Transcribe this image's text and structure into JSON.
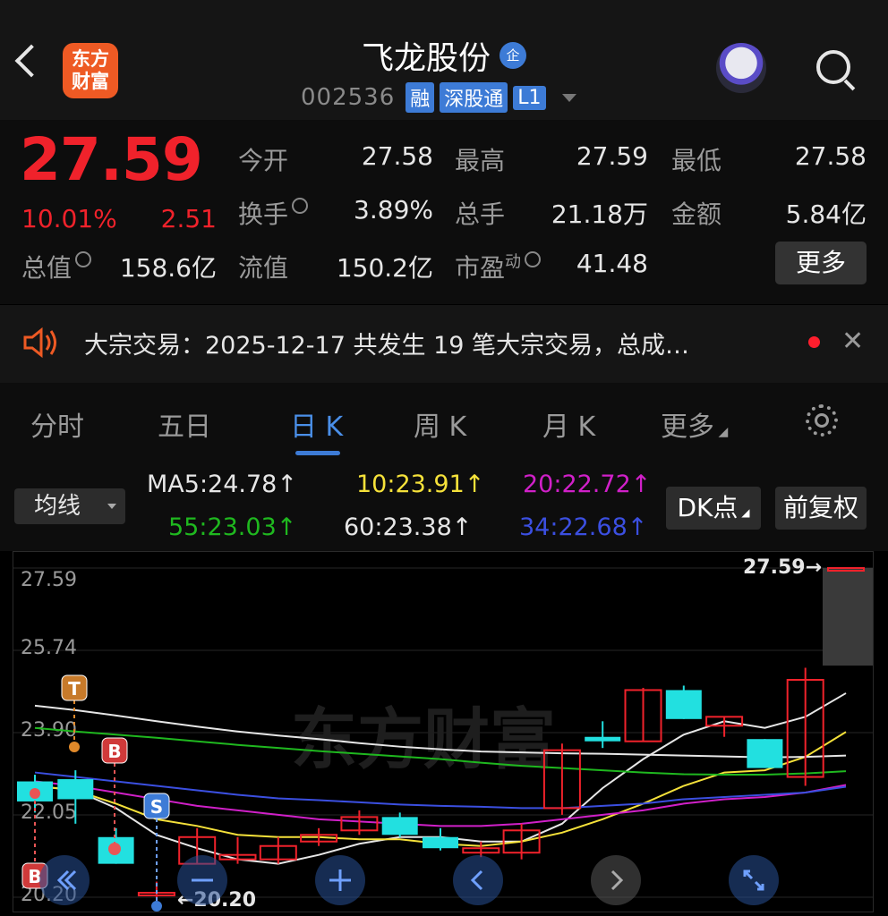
{
  "header": {
    "logo_line1": "东方",
    "logo_line2": "财富",
    "stock_name": "飞龙股份",
    "badge": "企",
    "code": "002536",
    "tags": [
      "融",
      "深股通",
      "L1"
    ]
  },
  "quote": {
    "price": "27.59",
    "change_pct": "10.01%",
    "change_amt": "2.51",
    "fields": [
      {
        "label": "今开",
        "value": "27.58",
        "color": "red"
      },
      {
        "label": "最高",
        "value": "27.59",
        "color": "red"
      },
      {
        "label": "最低",
        "value": "27.58",
        "color": "red"
      },
      {
        "label": "换手",
        "value": "3.89%"
      },
      {
        "label": "总手",
        "value": "21.18万"
      },
      {
        "label": "金额",
        "value": "5.84亿"
      },
      {
        "label": "总值",
        "value": "158.6亿"
      },
      {
        "label": "流值",
        "value": "150.2亿"
      },
      {
        "label": "市盈",
        "label_sup": "动",
        "value": "41.48"
      }
    ],
    "more_label": "更多"
  },
  "notice": {
    "text": "大宗交易：2025-12-17 共发生 19 笔大宗交易，总成…"
  },
  "tabs": [
    "分时",
    "五日",
    "日 K",
    "周 K",
    "月 K",
    "更多"
  ],
  "active_tab": "日 K",
  "ma_panel": {
    "selector": "均线",
    "items": [
      {
        "label": "MA5:24.78↑",
        "color": "#e6e6e6"
      },
      {
        "label": "10:23.91↑",
        "color": "#f5e13a"
      },
      {
        "label": "20:22.72↑",
        "color": "#d020c8"
      },
      {
        "label": "55:23.03↑",
        "color": "#1fb81f"
      },
      {
        "label": "60:23.38↑",
        "color": "#e6e6e6"
      },
      {
        "label": "34:22.68↑",
        "color": "#3b4fe0"
      }
    ],
    "dk_button": "DK点",
    "fq_button": "前复权"
  },
  "chart_data": {
    "type": "candlestick",
    "y_ticks": [
      "27.59",
      "25.74",
      "23.90",
      "22.05",
      "20.20"
    ],
    "ylim": [
      20.2,
      27.59
    ],
    "last_price_label": "27.59→",
    "low_label": "←20.20",
    "watermark": "东方财富",
    "markers": [
      "T",
      "B",
      "S",
      "B"
    ],
    "candles": [
      {
        "o": 22.8,
        "c": 22.35,
        "h": 22.95,
        "l": 22.1,
        "up": false
      },
      {
        "o": 22.85,
        "c": 22.4,
        "h": 23.05,
        "l": 21.85,
        "up": false
      },
      {
        "o": 21.55,
        "c": 20.95,
        "h": 21.75,
        "l": 20.95,
        "up": false
      },
      {
        "o": 20.3,
        "c": 20.3,
        "h": 20.55,
        "l": 20.2,
        "up": true
      },
      {
        "o": 20.95,
        "c": 21.55,
        "h": 21.75,
        "l": 20.95,
        "up": true
      },
      {
        "o": 21.05,
        "c": 21.15,
        "h": 21.55,
        "l": 20.95,
        "up": true
      },
      {
        "o": 21.05,
        "c": 21.35,
        "h": 21.55,
        "l": 20.95,
        "up": true
      },
      {
        "o": 21.45,
        "c": 21.6,
        "h": 21.75,
        "l": 21.35,
        "up": true
      },
      {
        "o": 21.7,
        "c": 22.0,
        "h": 22.15,
        "l": 21.6,
        "up": true
      },
      {
        "o": 22.0,
        "c": 21.6,
        "h": 22.1,
        "l": 21.55,
        "up": false
      },
      {
        "o": 21.55,
        "c": 21.3,
        "h": 21.75,
        "l": 21.25,
        "up": false
      },
      {
        "o": 21.2,
        "c": 21.3,
        "h": 21.45,
        "l": 21.1,
        "up": true
      },
      {
        "o": 21.2,
        "c": 21.7,
        "h": 21.85,
        "l": 21.05,
        "up": true
      },
      {
        "o": 22.2,
        "c": 23.5,
        "h": 23.65,
        "l": 22.05,
        "up": true
      },
      {
        "o": 23.7,
        "c": 23.8,
        "h": 24.15,
        "l": 23.55,
        "up": false
      },
      {
        "o": 23.7,
        "c": 24.85,
        "h": 24.9,
        "l": 23.7,
        "up": true
      },
      {
        "o": 24.85,
        "c": 24.2,
        "h": 24.95,
        "l": 24.2,
        "up": false
      },
      {
        "o": 24.05,
        "c": 24.25,
        "h": 24.25,
        "l": 23.8,
        "up": true
      },
      {
        "o": 23.75,
        "c": 23.1,
        "h": 23.75,
        "l": 23.1,
        "up": false
      },
      {
        "o": 22.9,
        "c": 25.08,
        "h": 25.35,
        "l": 22.7,
        "up": true
      },
      {
        "o": 27.59,
        "c": 27.59,
        "h": 27.59,
        "l": 27.58,
        "up": true
      }
    ],
    "series": [
      {
        "name": "MA5",
        "color": "#e6e6e6",
        "values": [
          22.7,
          22.6,
          22.2,
          21.6,
          21.3,
          21.05,
          20.95,
          21.15,
          21.4,
          21.55,
          21.55,
          21.45,
          21.45,
          21.85,
          22.65,
          23.3,
          23.85,
          24.15,
          24.0,
          24.25,
          24.78
        ]
      },
      {
        "name": "10",
        "color": "#f5e13a",
        "values": [
          22.7,
          22.6,
          22.3,
          21.95,
          21.8,
          21.6,
          21.55,
          21.55,
          21.5,
          21.5,
          21.4,
          21.35,
          21.45,
          21.65,
          21.95,
          22.3,
          22.7,
          23.0,
          23.05,
          23.35,
          23.91
        ]
      },
      {
        "name": "20",
        "color": "#d020c8",
        "values": [
          22.8,
          22.7,
          22.55,
          22.4,
          22.25,
          22.15,
          22.05,
          21.95,
          21.9,
          21.85,
          21.8,
          21.8,
          21.85,
          21.95,
          22.05,
          22.15,
          22.3,
          22.4,
          22.45,
          22.55,
          22.72
        ]
      },
      {
        "name": "34",
        "color": "#3b4fe0",
        "values": [
          23.0,
          22.9,
          22.8,
          22.7,
          22.6,
          22.5,
          22.42,
          22.38,
          22.33,
          22.28,
          22.25,
          22.23,
          22.2,
          22.2,
          22.25,
          22.3,
          22.4,
          22.45,
          22.5,
          22.55,
          22.68
        ]
      },
      {
        "name": "55",
        "color": "#1fb81f",
        "values": [
          24.0,
          23.92,
          23.85,
          23.78,
          23.7,
          23.62,
          23.55,
          23.48,
          23.42,
          23.36,
          23.3,
          23.22,
          23.15,
          23.1,
          23.05,
          23.0,
          22.96,
          22.95,
          22.95,
          22.98,
          23.03
        ]
      },
      {
        "name": "60",
        "color": "#e6e6e6",
        "values": [
          24.5,
          24.4,
          24.28,
          24.15,
          24.03,
          23.92,
          23.83,
          23.75,
          23.66,
          23.58,
          23.52,
          23.47,
          23.45,
          23.43,
          23.42,
          23.4,
          23.38,
          23.36,
          23.34,
          23.35,
          23.38
        ]
      }
    ]
  }
}
